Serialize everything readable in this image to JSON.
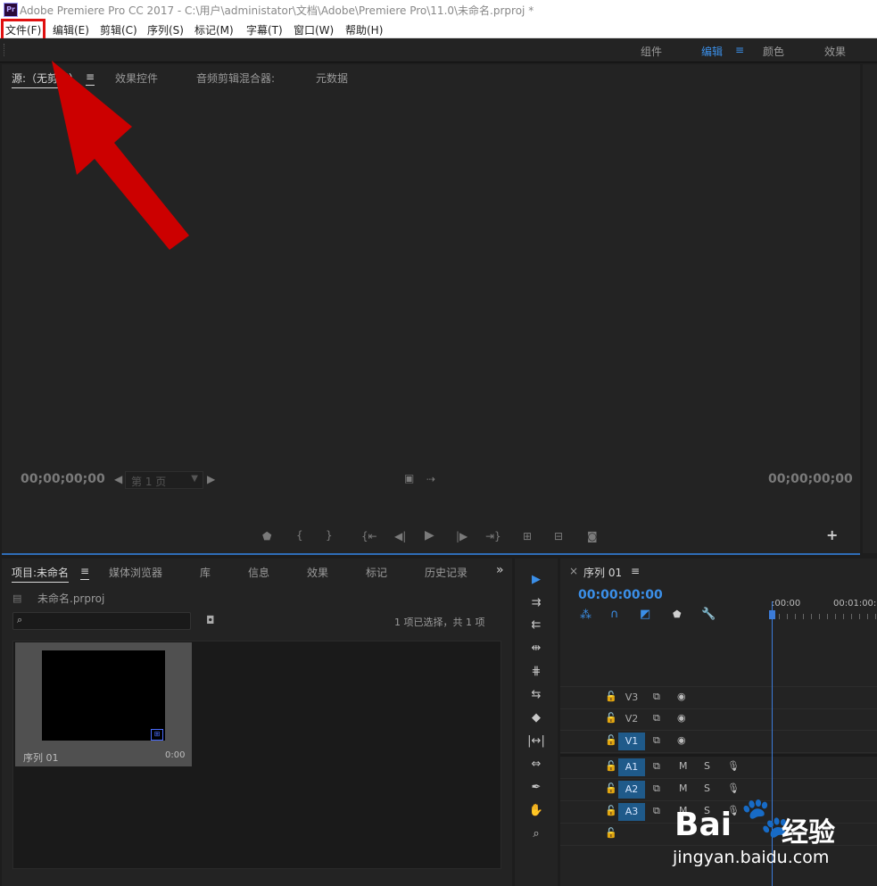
{
  "titlebar": {
    "logo": "Pr",
    "title": "Adobe Premiere Pro CC 2017 - C:\\用户\\administator\\文档\\Adobe\\Premiere Pro\\11.0\\未命名.prproj *"
  },
  "menu": [
    "文件(F)",
    "编辑(E)",
    "剪辑(C)",
    "序列(S)",
    "标记(M)",
    "字幕(T)",
    "窗口(W)",
    "帮助(H)"
  ],
  "workspaces": {
    "items": [
      "组件",
      "编辑",
      "颜色",
      "效果"
    ],
    "active": "编辑",
    "menu_icon": "≡"
  },
  "source_panel": {
    "tabs": [
      "源:（无剪辑）",
      "效果控件",
      "音频剪辑混合器:",
      "元数据"
    ],
    "tab_menu_icon": "≡",
    "timecode_left": "00;00;00;00",
    "timecode_right": "00;00;00;00",
    "page_select": "第 1 页",
    "controls": [
      "marker-icon",
      "mark-in-icon",
      "mark-out-icon",
      "go-to-in-icon",
      "step-back-icon",
      "play-icon",
      "step-forward-icon",
      "go-to-out-icon",
      "insert-icon",
      "overwrite-icon",
      "export-frame-icon"
    ],
    "add_button": "+"
  },
  "project_panel": {
    "tabs": [
      "项目:未命名",
      "媒体浏览器",
      "库",
      "信息",
      "效果",
      "标记",
      "历史记录"
    ],
    "tab_menu_icon": "≡",
    "more_icon": "»",
    "project_file": "未命名.prproj",
    "search_placeholder": "",
    "selection_info": "1 项已选择，共 1 项",
    "item": {
      "name": "序列 01",
      "duration": "0:00"
    }
  },
  "timeline_panel": {
    "close_icon": "×",
    "sequence_name": "序列 01",
    "menu_icon": "≡",
    "timecode": "00:00:00:00",
    "ruler_labels": [
      ":00:00",
      "00:01:00:"
    ],
    "video_tracks": [
      {
        "name": "V3",
        "target": false
      },
      {
        "name": "V2",
        "target": false
      },
      {
        "name": "V1",
        "target": true
      }
    ],
    "audio_tracks": [
      {
        "name": "A1",
        "target": true,
        "m": "M",
        "s": "S"
      },
      {
        "name": "A2",
        "target": true,
        "m": "M",
        "s": "S"
      },
      {
        "name": "A3",
        "target": true,
        "m": "M",
        "s": "S"
      }
    ]
  },
  "colors": {
    "accent_blue": "#3b8fe8",
    "annotation_red": "#cc0000"
  },
  "watermark": {
    "brand_left": "Bai",
    "brand_cn": "经验",
    "url": "jingyan.baidu.com"
  }
}
